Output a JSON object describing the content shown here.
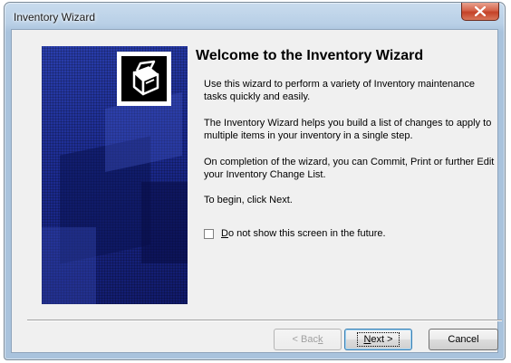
{
  "window": {
    "title": "Inventory Wizard",
    "close_icon": "close-icon"
  },
  "wizard": {
    "heading": "Welcome to the Inventory Wizard",
    "paragraphs": [
      "Use this wizard to perform a variety of Inventory maintenance tasks quickly and easily.",
      "The Inventory Wizard helps you build a list of changes to apply to multiple items in your inventory in a single step.",
      "On completion of the wizard, you can Commit, Print or further Edit your Inventory Change List.",
      "To begin, click Next."
    ],
    "checkbox": {
      "label_mnemonic": "D",
      "label_rest": "o not show this screen in the future.",
      "checked": false
    },
    "logo_icon": "inventory-box-icon"
  },
  "buttons": {
    "back": {
      "prefix": "< Bac",
      "mnemonic": "k",
      "enabled": false
    },
    "next": {
      "mnemonic": "N",
      "suffix": "ext >",
      "enabled": true
    },
    "cancel": {
      "label": "Cancel",
      "enabled": true
    }
  }
}
